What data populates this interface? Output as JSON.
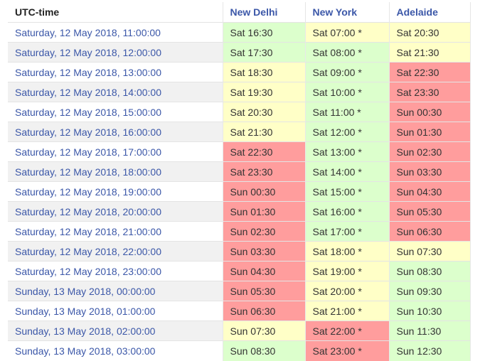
{
  "header": {
    "utc_label": "UTC-time",
    "cities": [
      "New Delhi",
      "New York",
      "Adelaide"
    ]
  },
  "legend_colors": {
    "green": "#dcffcc",
    "yellow": "#ffffc7",
    "red": "#ff9d9d"
  },
  "rows": [
    {
      "utc": "Saturday, 12 May 2018, 11:00:00",
      "cells": [
        {
          "t": "Sat 16:30",
          "c": "green"
        },
        {
          "t": "Sat 07:00 *",
          "c": "yellow"
        },
        {
          "t": "Sat 20:30",
          "c": "yellow"
        }
      ]
    },
    {
      "utc": "Saturday, 12 May 2018, 12:00:00",
      "cells": [
        {
          "t": "Sat 17:30",
          "c": "green"
        },
        {
          "t": "Sat 08:00 *",
          "c": "green"
        },
        {
          "t": "Sat 21:30",
          "c": "yellow"
        }
      ]
    },
    {
      "utc": "Saturday, 12 May 2018, 13:00:00",
      "cells": [
        {
          "t": "Sat 18:30",
          "c": "yellow"
        },
        {
          "t": "Sat 09:00 *",
          "c": "green"
        },
        {
          "t": "Sat 22:30",
          "c": "red"
        }
      ]
    },
    {
      "utc": "Saturday, 12 May 2018, 14:00:00",
      "cells": [
        {
          "t": "Sat 19:30",
          "c": "yellow"
        },
        {
          "t": "Sat 10:00 *",
          "c": "green"
        },
        {
          "t": "Sat 23:30",
          "c": "red"
        }
      ]
    },
    {
      "utc": "Saturday, 12 May 2018, 15:00:00",
      "cells": [
        {
          "t": "Sat 20:30",
          "c": "yellow"
        },
        {
          "t": "Sat 11:00 *",
          "c": "green"
        },
        {
          "t": "Sun 00:30",
          "c": "red"
        }
      ]
    },
    {
      "utc": "Saturday, 12 May 2018, 16:00:00",
      "cells": [
        {
          "t": "Sat 21:30",
          "c": "yellow"
        },
        {
          "t": "Sat 12:00 *",
          "c": "green"
        },
        {
          "t": "Sun 01:30",
          "c": "red"
        }
      ]
    },
    {
      "utc": "Saturday, 12 May 2018, 17:00:00",
      "cells": [
        {
          "t": "Sat 22:30",
          "c": "red"
        },
        {
          "t": "Sat 13:00 *",
          "c": "green"
        },
        {
          "t": "Sun 02:30",
          "c": "red"
        }
      ]
    },
    {
      "utc": "Saturday, 12 May 2018, 18:00:00",
      "cells": [
        {
          "t": "Sat 23:30",
          "c": "red"
        },
        {
          "t": "Sat 14:00 *",
          "c": "green"
        },
        {
          "t": "Sun 03:30",
          "c": "red"
        }
      ]
    },
    {
      "utc": "Saturday, 12 May 2018, 19:00:00",
      "cells": [
        {
          "t": "Sun 00:30",
          "c": "red"
        },
        {
          "t": "Sat 15:00 *",
          "c": "green"
        },
        {
          "t": "Sun 04:30",
          "c": "red"
        }
      ]
    },
    {
      "utc": "Saturday, 12 May 2018, 20:00:00",
      "cells": [
        {
          "t": "Sun 01:30",
          "c": "red"
        },
        {
          "t": "Sat 16:00 *",
          "c": "green"
        },
        {
          "t": "Sun 05:30",
          "c": "red"
        }
      ]
    },
    {
      "utc": "Saturday, 12 May 2018, 21:00:00",
      "cells": [
        {
          "t": "Sun 02:30",
          "c": "red"
        },
        {
          "t": "Sat 17:00 *",
          "c": "green"
        },
        {
          "t": "Sun 06:30",
          "c": "red"
        }
      ]
    },
    {
      "utc": "Saturday, 12 May 2018, 22:00:00",
      "cells": [
        {
          "t": "Sun 03:30",
          "c": "red"
        },
        {
          "t": "Sat 18:00 *",
          "c": "yellow"
        },
        {
          "t": "Sun 07:30",
          "c": "yellow"
        }
      ]
    },
    {
      "utc": "Saturday, 12 May 2018, 23:00:00",
      "cells": [
        {
          "t": "Sun 04:30",
          "c": "red"
        },
        {
          "t": "Sat 19:00 *",
          "c": "yellow"
        },
        {
          "t": "Sun 08:30",
          "c": "green"
        }
      ]
    },
    {
      "utc": "Sunday, 13 May 2018, 00:00:00",
      "cells": [
        {
          "t": "Sun 05:30",
          "c": "red"
        },
        {
          "t": "Sat 20:00 *",
          "c": "yellow"
        },
        {
          "t": "Sun 09:30",
          "c": "green"
        }
      ]
    },
    {
      "utc": "Sunday, 13 May 2018, 01:00:00",
      "cells": [
        {
          "t": "Sun 06:30",
          "c": "red"
        },
        {
          "t": "Sat 21:00 *",
          "c": "yellow"
        },
        {
          "t": "Sun 10:30",
          "c": "green"
        }
      ]
    },
    {
      "utc": "Sunday, 13 May 2018, 02:00:00",
      "cells": [
        {
          "t": "Sun 07:30",
          "c": "yellow"
        },
        {
          "t": "Sat 22:00 *",
          "c": "red"
        },
        {
          "t": "Sun 11:30",
          "c": "green"
        }
      ]
    },
    {
      "utc": "Sunday, 13 May 2018, 03:00:00",
      "cells": [
        {
          "t": "Sun 08:30",
          "c": "green"
        },
        {
          "t": "Sat 23:00 *",
          "c": "red"
        },
        {
          "t": "Sun 12:30",
          "c": "green"
        }
      ]
    }
  ]
}
